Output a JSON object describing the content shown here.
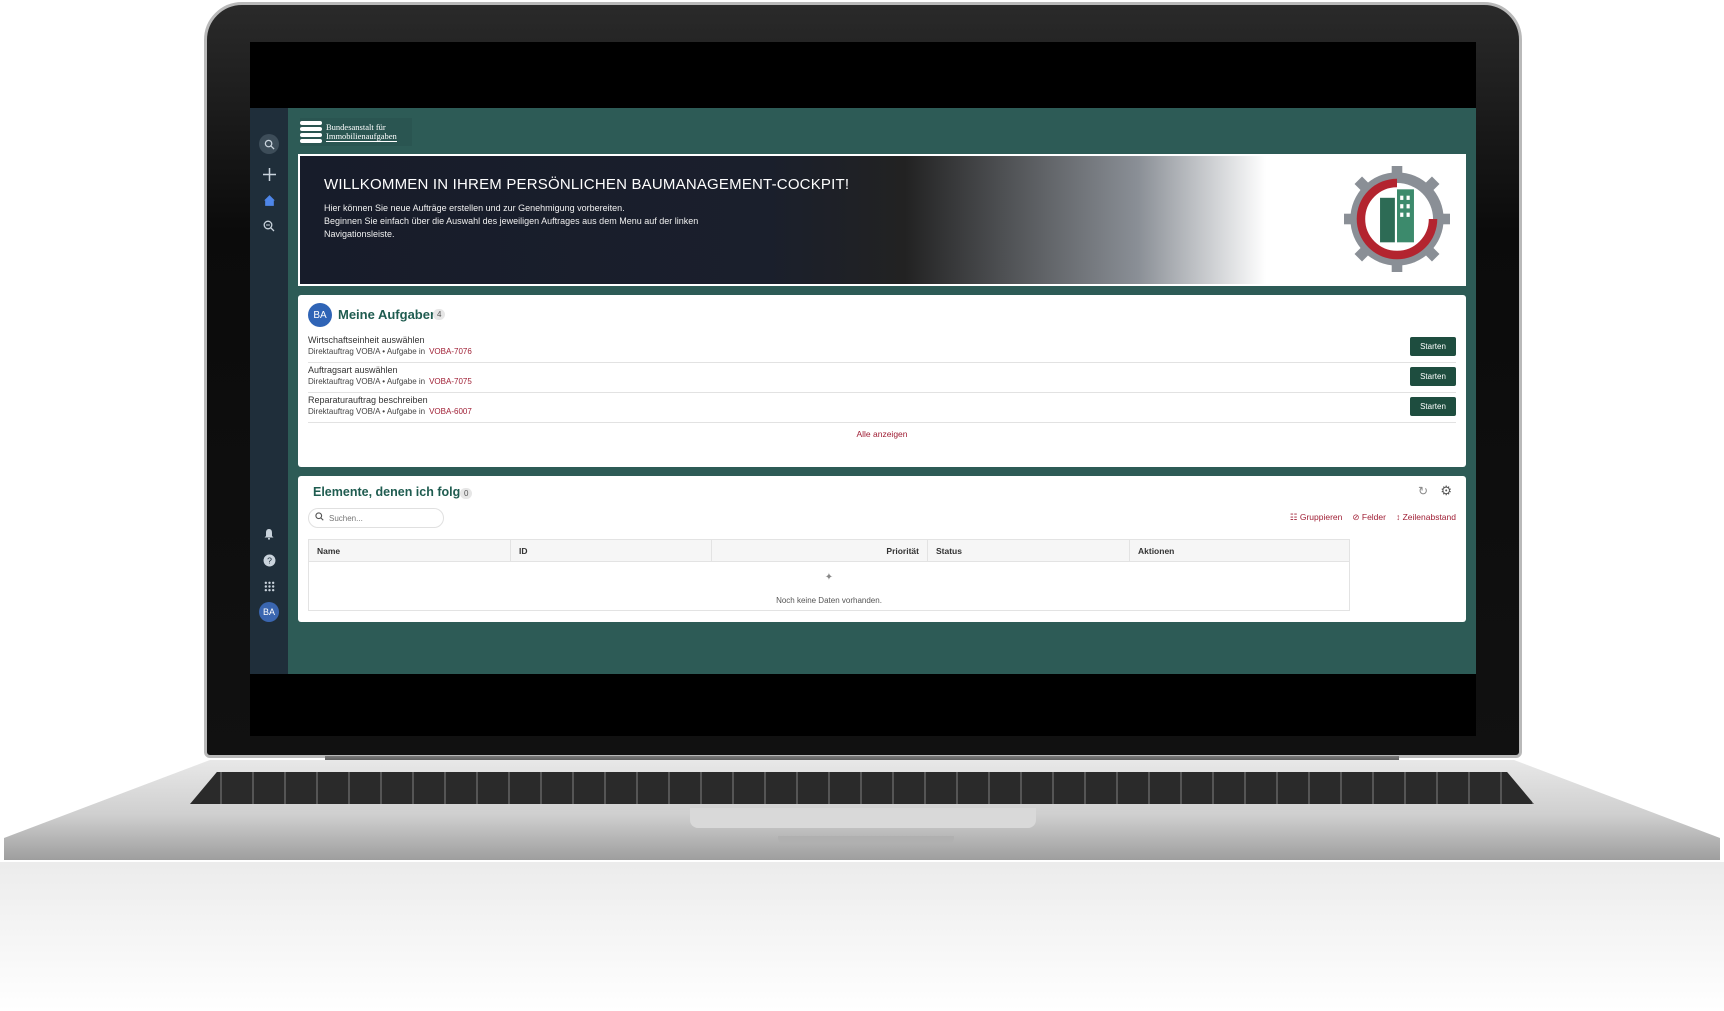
{
  "org": {
    "name_line1": "Bundesanstalt für",
    "name_line2": "Immobilienaufgaben"
  },
  "banner": {
    "title": "WILLKOMMEN IN IHREM PERSÖNLICHEN BAUMANAGEMENT-COCKPIT!",
    "line1": "Hier können Sie neue Aufträge erstellen und zur Genehmigung vorbereiten.",
    "line2": "Beginnen Sie einfach über die Auswahl des jeweiligen Auftrages aus dem Menu auf der linken Navigationsleiste."
  },
  "sidebar": {
    "avatar_initials": "BA"
  },
  "tasks": {
    "avatar_initials": "BA",
    "title": "Meine Aufgaben",
    "count": "4",
    "items": [
      {
        "name": "Wirtschaftseinheit auswählen",
        "meta": "Direktauftrag VOB/A  • Aufgabe in",
        "link": "VOBA-7076",
        "button": "Starten"
      },
      {
        "name": "Auftragsart auswählen",
        "meta": "Direktauftrag VOB/A  • Aufgabe in",
        "link": "VOBA-7075",
        "button": "Starten"
      },
      {
        "name": "Reparaturauftrag beschreiben",
        "meta": "Direktauftrag VOB/A  • Aufgabe in",
        "link": "VOBA-6007",
        "button": "Starten"
      }
    ],
    "show_all": "Alle anzeigen"
  },
  "follow": {
    "title": "Elemente, denen ich folge",
    "count": "0",
    "search_placeholder": "Suchen...",
    "toolbar": {
      "group": "Gruppieren",
      "fields": "Felder",
      "spacing": "Zeilenabstand"
    },
    "columns": [
      "Name",
      "ID",
      "Priorität",
      "Status",
      "Aktionen"
    ],
    "empty": "Noch keine Daten vorhanden."
  },
  "colors": {
    "app_bg": "#2d5b56",
    "sidebar": "#1f2e3a",
    "accent": "#1e4d3f",
    "link": "#a02036"
  }
}
